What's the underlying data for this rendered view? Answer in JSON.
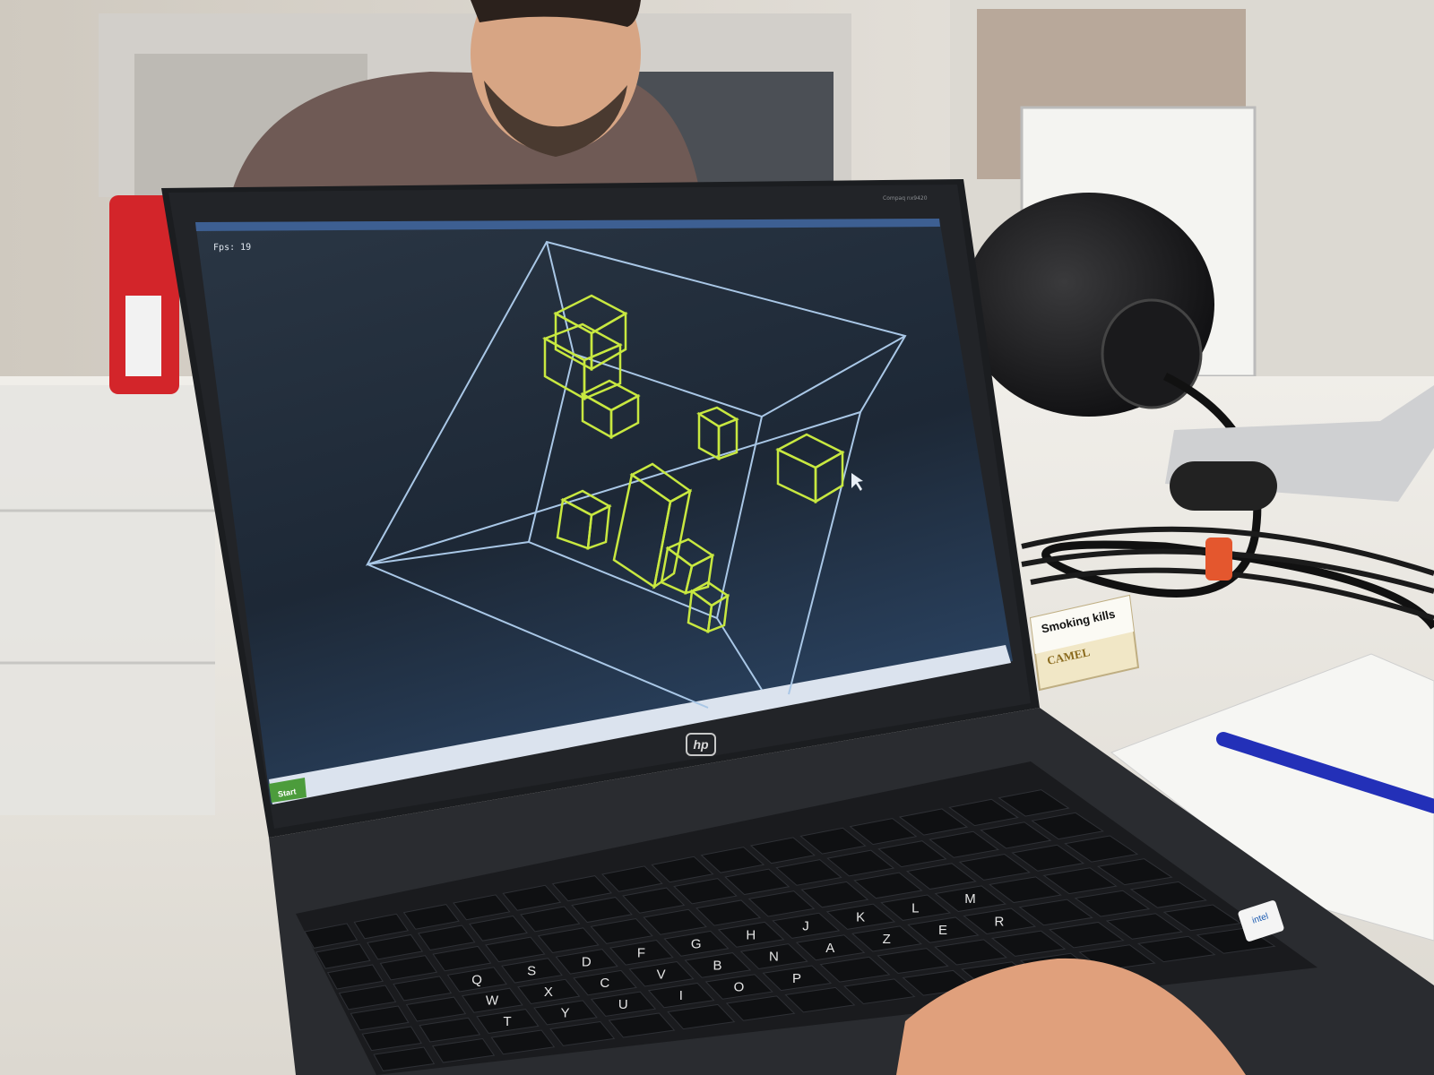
{
  "screen": {
    "fps_label": "Fps: 19",
    "brand_label": "Compaq nx9420",
    "taskbar": {
      "start_label": "Start",
      "tasks": [
        "",
        "",
        "",
        ""
      ]
    },
    "colors": {
      "desktop_bg": "#1f2a36",
      "wire_room": "#a9c7e6",
      "wire_cubes": "#c8e840"
    }
  },
  "laptop": {
    "logo_text": "hp",
    "intel_badge": "intel",
    "key_labels": [
      "Q",
      "S",
      "D",
      "F",
      "G",
      "H",
      "J",
      "K",
      "L",
      "M",
      "W",
      "X",
      "C",
      "V",
      "B",
      "N",
      "A",
      "Z",
      "E",
      "R",
      "T",
      "Y",
      "U",
      "I",
      "O",
      "P"
    ]
  },
  "desk": {
    "cigarette_box_text": "Smoking kills",
    "cigarette_brand": "CAMEL"
  }
}
